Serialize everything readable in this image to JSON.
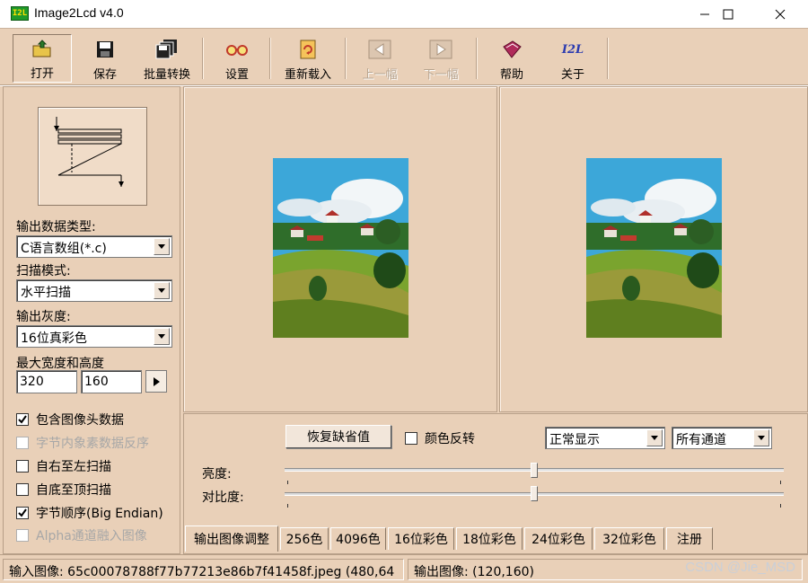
{
  "window": {
    "title": "Image2Lcd v4.0",
    "icon_text": "I2L",
    "controls": [
      "minimize-icon",
      "maximize-icon",
      "close-icon"
    ]
  },
  "toolbar": {
    "open": "打开",
    "save": "保存",
    "batch": "批量转换",
    "settings": "设置",
    "reload": "重新载入",
    "prev": "上一幅",
    "next": "下一幅",
    "help": "帮助",
    "about": "关于",
    "about_icon_text": "I2L"
  },
  "left": {
    "output_type_label": "输出数据类型:",
    "output_type_value": "C语言数组(*.c)",
    "scan_mode_label": "扫描模式:",
    "scan_mode_value": "水平扫描",
    "gray_label": "输出灰度:",
    "gray_value": "16位真彩色",
    "maxsize_label": "最大宽度和高度",
    "max_width": "320",
    "max_height": "160",
    "checkboxes": [
      {
        "label": "包含图像头数据",
        "checked": true,
        "enabled": true
      },
      {
        "label": "字节内象素数据反序",
        "checked": false,
        "enabled": false
      },
      {
        "label": "自右至左扫描",
        "checked": false,
        "enabled": true
      },
      {
        "label": "自底至顶扫描",
        "checked": false,
        "enabled": true
      },
      {
        "label": "字节顺序(Big Endian)",
        "checked": true,
        "enabled": true
      },
      {
        "label": "Alpha通道融入图像",
        "checked": false,
        "enabled": false
      }
    ]
  },
  "adjust": {
    "reset_button": "恢复缺省值",
    "invert_label": "颜色反转",
    "display_mode": "正常显示",
    "channel": "所有通道",
    "brightness_label": "亮度:",
    "contrast_label": "对比度:",
    "brightness_level": 0.5,
    "contrast_level": 0.5
  },
  "tabs": [
    "输出图像调整",
    "256色",
    "4096色",
    "16位彩色",
    "18位彩色",
    "24位彩色",
    "32位彩色",
    "注册"
  ],
  "status": {
    "input": "输入图像: 65c00078788f77b77213e86b7f41458f.jpeg (480,64",
    "output": "输出图像: (120,160)",
    "watermark": "CSDN @Jie_MSD"
  },
  "colors": {
    "panel": "#e9d0b8",
    "app_icon": "#1f9a2a"
  }
}
